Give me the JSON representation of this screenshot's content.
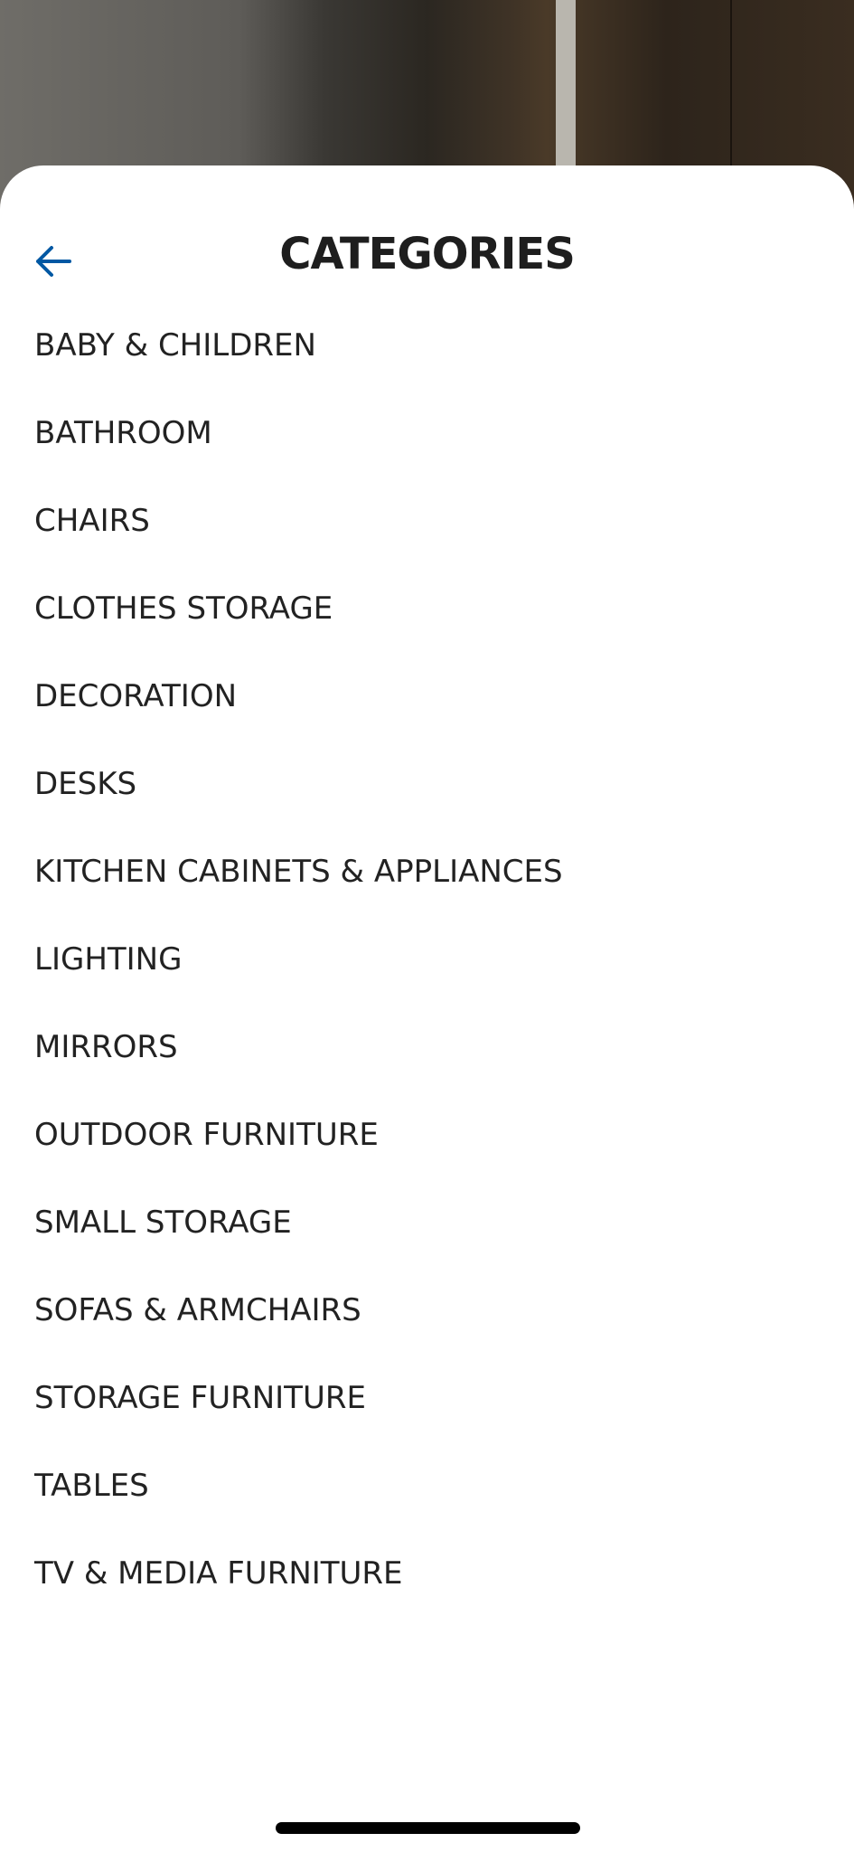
{
  "header": {
    "title": "CATEGORIES",
    "back_icon": "arrow-left-icon"
  },
  "colors": {
    "accent": "#0058a3",
    "text": "#222222",
    "sheet_bg": "#ffffff"
  },
  "categories": [
    {
      "label": "BABY & CHILDREN"
    },
    {
      "label": "BATHROOM"
    },
    {
      "label": "CHAIRS"
    },
    {
      "label": "CLOTHES STORAGE"
    },
    {
      "label": "DECORATION"
    },
    {
      "label": "DESKS"
    },
    {
      "label": "KITCHEN CABINETS & APPLIANCES"
    },
    {
      "label": "LIGHTING"
    },
    {
      "label": "MIRRORS"
    },
    {
      "label": "OUTDOOR FURNITURE"
    },
    {
      "label": "SMALL STORAGE"
    },
    {
      "label": "SOFAS & ARMCHAIRS"
    },
    {
      "label": "STORAGE FURNITURE"
    },
    {
      "label": "TABLES"
    },
    {
      "label": "TV & MEDIA FURNITURE"
    }
  ]
}
